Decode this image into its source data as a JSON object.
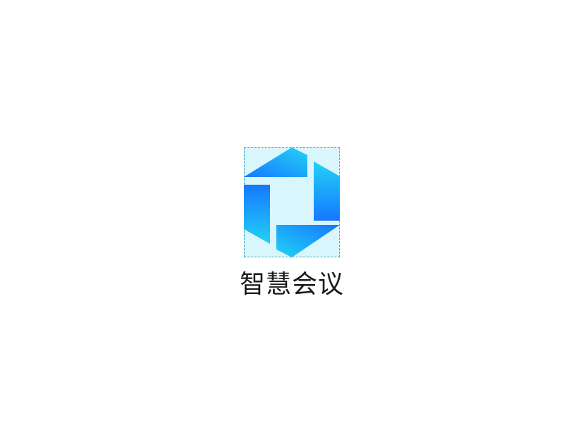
{
  "desktop": {
    "app": {
      "label": "智慧会议",
      "icon": "hexagon-shutter-logo-icon",
      "colors": {
        "tile_background": "#d9f6fc",
        "selection_border": "#3aa8bf",
        "gradient_deep": "#1677ff",
        "gradient_light": "#22d3f5"
      }
    }
  }
}
